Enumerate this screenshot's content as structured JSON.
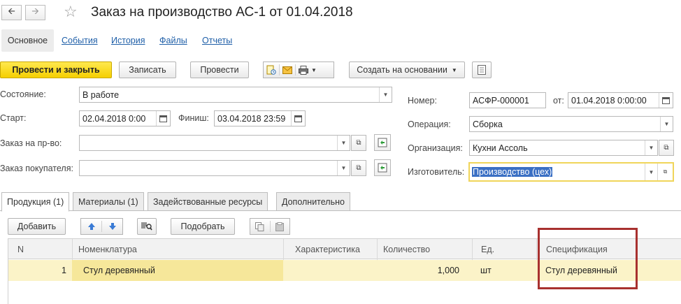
{
  "window": {
    "title": "Заказ на производство АС-1 от 01.04.2018",
    "back_icon": "arrow-left-icon",
    "forward_icon": "arrow-right-icon",
    "favorite_icon": "star-icon"
  },
  "section_tabs": [
    {
      "label": "Основное",
      "active": true
    },
    {
      "label": "События"
    },
    {
      "label": "История"
    },
    {
      "label": "Файлы"
    },
    {
      "label": "Отчеты"
    }
  ],
  "toolbar": {
    "post_close": "Провести и закрыть",
    "save": "Записать",
    "post": "Провести",
    "create_based": "Создать на основании"
  },
  "form": {
    "state_label": "Состояние:",
    "state_value": "В работе",
    "start_label": "Старт:",
    "start_value": "02.04.2018  0:00",
    "finish_label": "Финиш:",
    "finish_value": "03.04.2018 23:59",
    "prod_order_label": "Заказ на пр-во:",
    "prod_order_value": "",
    "customer_order_label": "Заказ покупателя:",
    "customer_order_value": "",
    "number_label": "Номер:",
    "number_value": "АСФР-000001",
    "from_label": "от:",
    "date_value": "01.04.2018  0:00:00",
    "operation_label": "Операция:",
    "operation_value": "Сборка",
    "organization_label": "Организация:",
    "organization_value": "Кухни Ассоль",
    "manufacturer_label": "Изготовитель:",
    "manufacturer_value": "Производство (цех)"
  },
  "tabs": [
    {
      "label": "Продукция (1)",
      "active": true
    },
    {
      "label": "Материалы (1)"
    },
    {
      "label": "Задействованные ресурсы"
    },
    {
      "label": "Дополнительно"
    }
  ],
  "table_toolbar": {
    "add": "Добавить",
    "pick": "Подобрать"
  },
  "table": {
    "columns": [
      "N",
      "Номенклатура",
      "Характеристика",
      "Количество",
      "Ед.",
      "Спецификация"
    ],
    "rows": [
      {
        "n": "1",
        "item": "Стул деревянный",
        "characteristic": "",
        "quantity": "1,000",
        "unit": "шт",
        "spec": "Стул деревянный"
      }
    ]
  },
  "colors": {
    "primary_button": "#f5cf00",
    "highlight_row": "#fbf3c8",
    "annotation_box": "#a8312f",
    "link": "#1f5fa8"
  }
}
